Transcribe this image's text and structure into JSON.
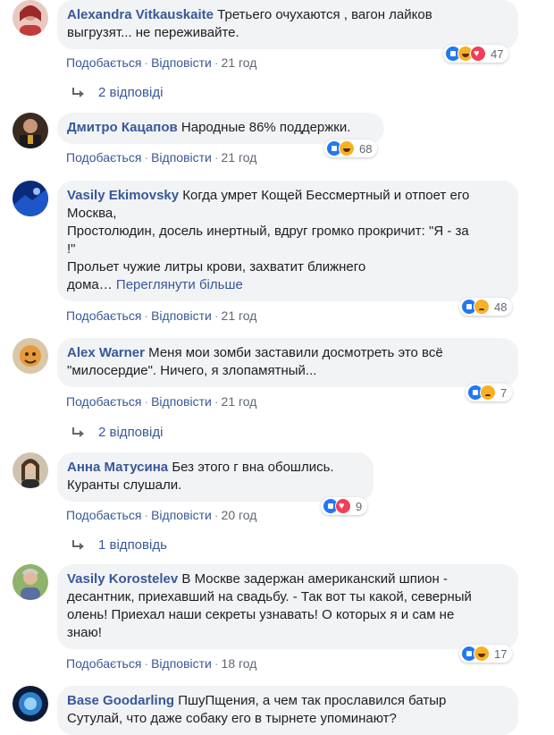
{
  "colors": {
    "link": "#385898",
    "bubble": "#f2f3f5",
    "meta": "#606770",
    "like": "#2078f4",
    "haha": "#f7b125",
    "love": "#f33e58"
  },
  "comments": [
    {
      "author": "Alexandra Vitkauskaite",
      "text": "Третьего очухаются , вагон лайков\nвыгрузят... не переживайте.",
      "like": "Подобається",
      "reply": "Відповісти",
      "time": "21 год",
      "reactions": [
        "like-icon",
        "haha-icon",
        "love-icon"
      ],
      "count": "47",
      "replies": "2 відповіді"
    },
    {
      "author": "Дмитро Кацапов",
      "text": "Народные 86% поддержки.",
      "like": "Подобається",
      "reply": "Відповісти",
      "time": "21 год",
      "reactions": [
        "like-icon",
        "haha-icon"
      ],
      "count": "68"
    },
    {
      "author": "Vasily Ekimovsky",
      "text": "Когда умрет Кощей Бессмертный и отпоет его\nМосква,\nПростолюдин, досель инертный, вдруг громко прокричит: \"Я - за\n!\"\nПрольет чужие литры крови, захватит ближнего\nдома…",
      "see_more": "Переглянути більше",
      "like": "Подобається",
      "reply": "Відповісти",
      "time": "21 год",
      "reactions": [
        "like-icon",
        "sad-icon"
      ],
      "count": "48"
    },
    {
      "author": "Alex Warner",
      "text": "Меня мои зомби заставили досмотреть это всё\n\"милосердие\". Ничего, я злопамятный...",
      "like": "Подобається",
      "reply": "Відповісти",
      "time": "21 год",
      "reactions": [
        "like-icon",
        "sad-icon"
      ],
      "count": "7",
      "replies": "2 відповіді"
    },
    {
      "author": "Анна Матусина",
      "text": "Без этого г вна обошлись.\nКуранты слушали.",
      "like": "Подобається",
      "reply": "Відповісти",
      "time": "20 год",
      "reactions": [
        "like-icon",
        "love-icon"
      ],
      "count": "9",
      "replies": "1 відповідь"
    },
    {
      "author": "Vasily Korostelev",
      "text": "В Москве задержан американский шпион -\nдесантник, приехавший на свадьбу. - Так вот ты какой, северный\nолень! Приехал наши секреты узнавать! О которых я и сам не\nзнаю!",
      "like": "Подобається",
      "reply": "Відповісти",
      "time": "18 год",
      "reactions": [
        "like-icon",
        "haha-icon"
      ],
      "count": "17"
    },
    {
      "author": "Base Goodarling",
      "text": "ПшуПщения, а чем так прославился батыр\nСутулай, что даже собаку его в тырнете упоминают?"
    }
  ]
}
